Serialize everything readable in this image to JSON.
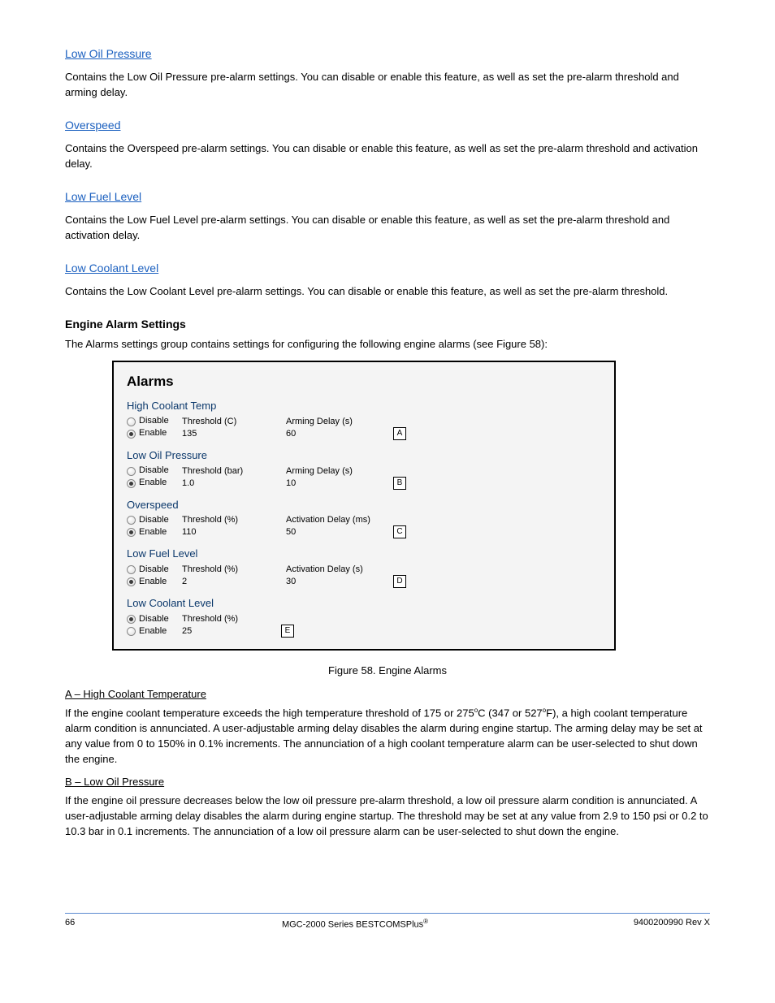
{
  "sections": {
    "low_oil_pressure": {
      "link": "Low Oil Pressure",
      "desc": "Contains the Low Oil Pressure pre-alarm settings. You can disable or enable this feature, as well as set the pre-alarm threshold and arming delay."
    },
    "overspeed": {
      "link": "Overspeed",
      "desc": "Contains the Overspeed pre-alarm settings. You can disable or enable this feature, as well as set the pre-alarm threshold and activation delay."
    },
    "low_fuel_level": {
      "link": "Low Fuel Level",
      "desc": "Contains the Low Fuel Level pre-alarm settings. You can disable or enable this feature, as well as set the pre-alarm threshold and activation delay."
    },
    "low_coolant_level": {
      "link": "Low Coolant Level",
      "desc": "Contains the Low Coolant Level pre-alarm settings. You can disable or enable this feature, as well as set the pre-alarm threshold."
    }
  },
  "alarms_block_heading": "Engine Alarm Settings",
  "alarms_block_para": "The Alarms settings group contains settings for configuring the following engine alarms (see Figure 58):",
  "figure_label": "Figure 58. Engine Alarms",
  "alarms": {
    "title": "Alarms",
    "groups": [
      {
        "name": "High Coolant Temp",
        "disable": "Disable",
        "enable": "Enable",
        "checked": "enable",
        "threshold_label": "Threshold (C)",
        "threshold_value": "135",
        "delay_label": "Arming Delay (s)",
        "delay_value": "60",
        "tag": "A"
      },
      {
        "name": "Low Oil Pressure",
        "disable": "Disable",
        "enable": "Enable",
        "checked": "enable",
        "threshold_label": "Threshold (bar)",
        "threshold_value": "1.0",
        "delay_label": "Arming Delay (s)",
        "delay_value": "10",
        "tag": "B"
      },
      {
        "name": "Overspeed",
        "disable": "Disable",
        "enable": "Enable",
        "checked": "enable",
        "threshold_label": "Threshold (%)",
        "threshold_value": "110",
        "delay_label": "Activation Delay (ms)",
        "delay_value": "50",
        "tag": "C"
      },
      {
        "name": "Low Fuel Level",
        "disable": "Disable",
        "enable": "Enable",
        "checked": "enable",
        "threshold_label": "Threshold (%)",
        "threshold_value": "2",
        "delay_label": "Activation Delay (s)",
        "delay_value": "30",
        "tag": "D"
      },
      {
        "name": "Low Coolant Level",
        "disable": "Disable",
        "enable": "Enable",
        "checked": "disable",
        "threshold_label": "Threshold (%)",
        "threshold_value": "25",
        "delay_label": "",
        "delay_value": "",
        "tag": "E"
      }
    ]
  },
  "subsections": {
    "a": {
      "title": "A – High Coolant Temperature",
      "para": "If the engine coolant temperature exceeds the high temperature threshold of 175 or 275",
      "unit_c": "C (347 or 527",
      "unit_f": "F), a high coolant temperature alarm condition is annunciated. A user-adjustable arming delay disables the alarm during engine startup. The arming delay may be set at any value from 0 to 150% in 0.1% increments. The annunciation of a high coolant temperature alarm can be user-selected to shut down the engine."
    },
    "b": {
      "title": "B – Low Oil Pressure",
      "para": "If the engine oil pressure decreases below the low oil pressure pre-alarm threshold, a low oil pressure alarm condition is annunciated. A user-adjustable arming delay disables the alarm during engine startup. The threshold may be set at any value from 2.9 to 150 psi or 0.2 to 10.3 bar in 0.1 increments. The annunciation of a low oil pressure alarm can be user-selected to shut down the engine."
    }
  },
  "footer": {
    "page": "66",
    "product": "MGC-2000 Series BESTCOMSPlus",
    "right_code": "9400200990 Rev X",
    "reg_mark": "®"
  }
}
